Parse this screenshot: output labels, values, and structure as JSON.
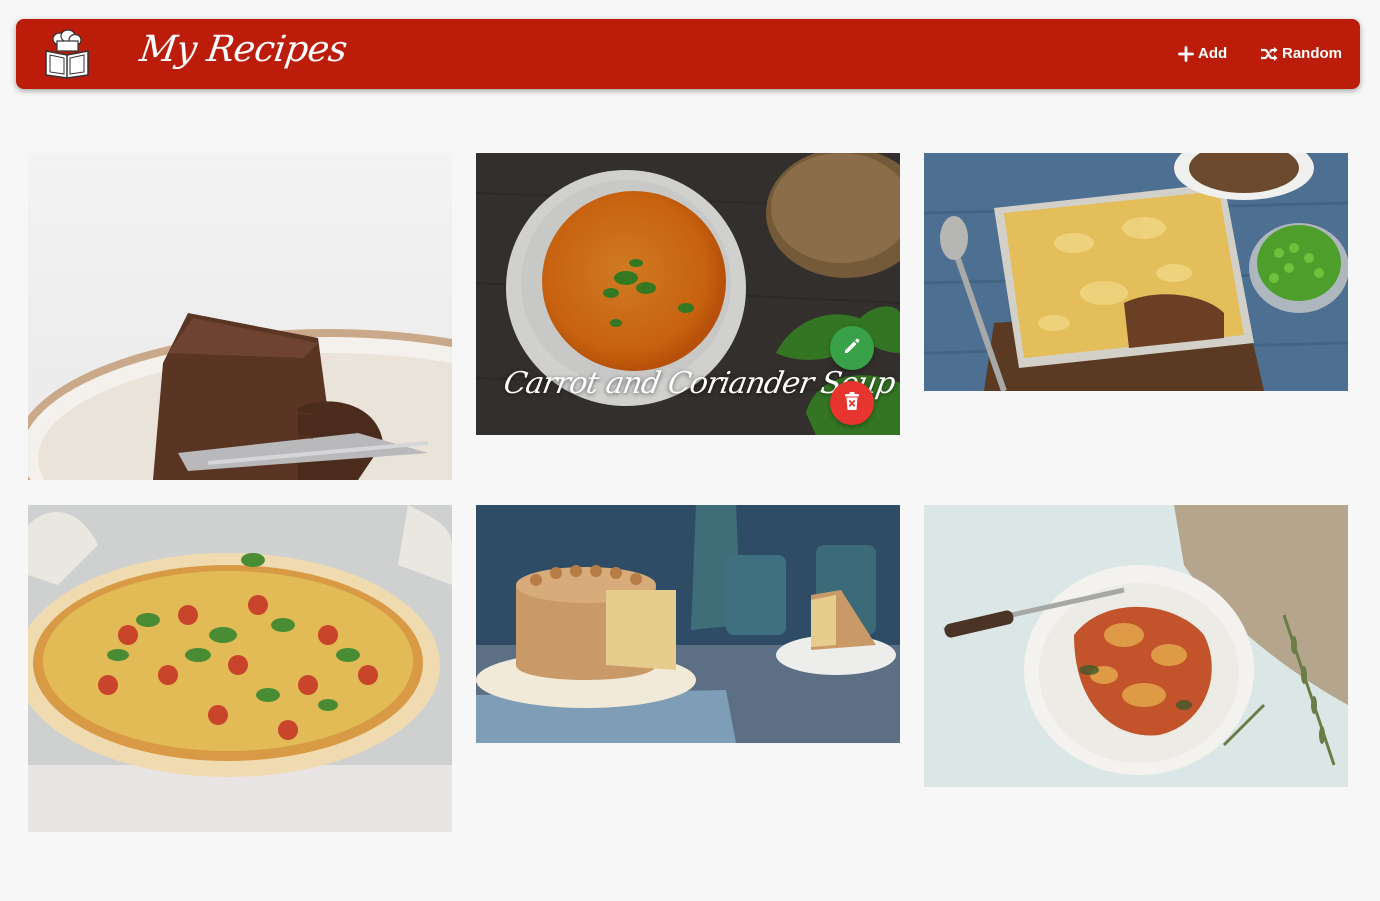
{
  "navbar": {
    "brand": "My Recipes",
    "logo_icon": "chef-book-icon",
    "add_label": "Add",
    "random_label": "Random",
    "color": "#bb1d0a"
  },
  "recipes": [
    {
      "image": "chocolate-cake-slice",
      "title": ""
    },
    {
      "image": "carrot-soup-bowl",
      "title": "Carrot and Coriander Soup",
      "hovered": true
    },
    {
      "image": "cottage-pie-with-peas",
      "title": ""
    },
    {
      "image": "margherita-pizza",
      "title": ""
    },
    {
      "image": "caramel-layer-cake",
      "title": ""
    },
    {
      "image": "lasagne-plate",
      "title": ""
    }
  ],
  "actions": {
    "edit_icon": "pencil-icon",
    "delete_icon": "trash-icon",
    "edit_color": "#39a248",
    "delete_color": "#e8342f"
  }
}
